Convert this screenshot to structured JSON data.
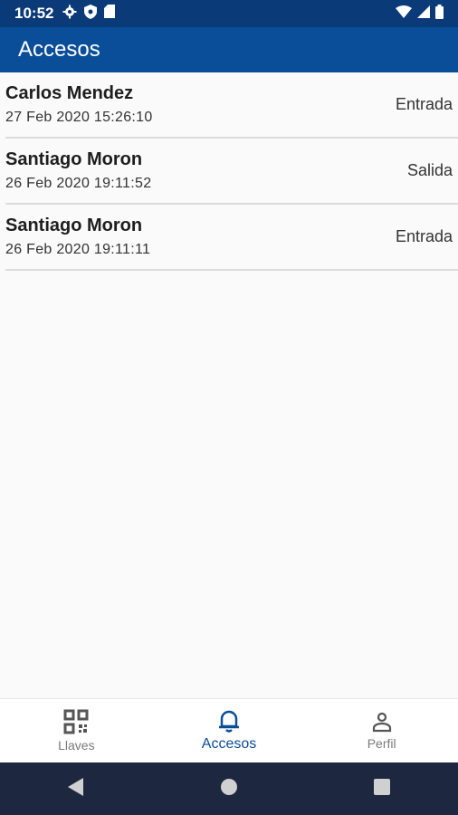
{
  "status_bar": {
    "time": "10:52",
    "left_icons": [
      "gear-icon",
      "shield-icon",
      "sd-card-icon"
    ],
    "right_icons": [
      "wifi-icon",
      "signal-icon",
      "battery-icon"
    ]
  },
  "app_bar": {
    "title": "Accesos"
  },
  "accesses": [
    {
      "name": "Carlos Mendez",
      "datetime": "27 Feb 2020 15:26:10",
      "type": "Entrada"
    },
    {
      "name": "Santiago Moron",
      "datetime": "26 Feb 2020 19:11:52",
      "type": "Salida"
    },
    {
      "name": "Santiago Moron",
      "datetime": "26 Feb 2020 19:11:11",
      "type": "Entrada"
    }
  ],
  "bottom_nav": {
    "items": [
      {
        "label": "Llaves",
        "icon": "qr-code-icon",
        "active": false
      },
      {
        "label": "Accesos",
        "icon": "bell-icon",
        "active": true
      },
      {
        "label": "Perfil",
        "icon": "person-icon",
        "active": false
      }
    ]
  },
  "system_nav": [
    "back-icon",
    "home-icon",
    "recents-icon"
  ],
  "colors": {
    "status_bar": "#0a3a78",
    "app_bar": "#0a4e9a",
    "accent": "#0a4e9a",
    "system_nav": "#1d2740"
  }
}
